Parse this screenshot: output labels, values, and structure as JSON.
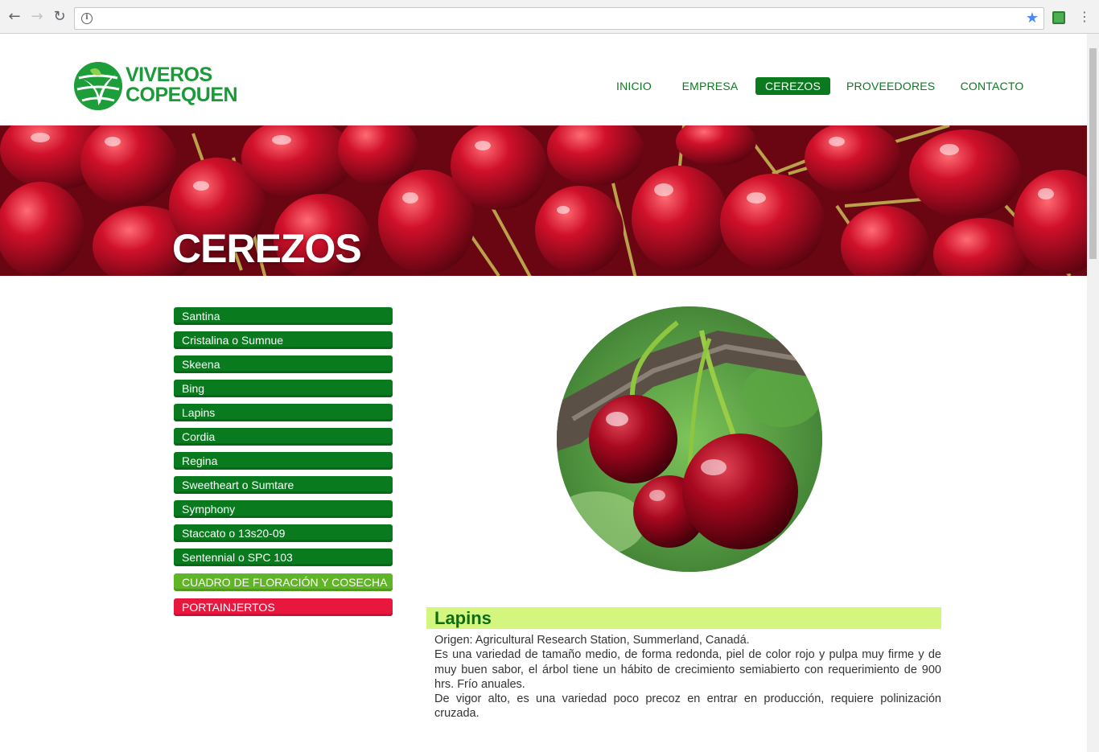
{
  "browser": {
    "url": "",
    "back_icon": "arrow-left-icon",
    "forward_icon": "arrow-right-icon",
    "reload_icon": "reload-icon"
  },
  "site": {
    "logo_line1": "VIVEROS",
    "logo_line2": "COPEQUEN",
    "nav": [
      {
        "label": "INICIO",
        "active": false
      },
      {
        "label": "EMPRESA",
        "active": false
      },
      {
        "label": "CEREZOS",
        "active": true
      },
      {
        "label": "PROVEEDORES",
        "active": false
      },
      {
        "label": "CONTACTO",
        "active": false
      }
    ],
    "brand_green": "#0b7a1e"
  },
  "banner": {
    "title": "CEREZOS"
  },
  "sidebar": {
    "items": [
      "Santina",
      "Cristalina o Sumnue",
      "Skeena",
      "Bing",
      "Lapins",
      "Cordia",
      "Regina",
      "Sweetheart o Sumtare",
      "Symphony",
      "Staccato o 13s20-09",
      "Sentennial o SPC 103"
    ],
    "cuadro": "CUADRO DE FLORACIÓN Y COSECHA",
    "portainjertos": "PORTAINJERTOS"
  },
  "variety": {
    "name": "Lapins",
    "paragraphs": [
      "Origen: Agricultural Research Station, Summerland, Canadá.",
      "Es una variedad de tamaño medio, de forma redonda, piel de color rojo y pulpa muy firme y de muy buen sabor, el árbol tiene un hábito de crecimiento semiabierto con requerimiento de 900 hrs. Frío anuales.",
      "De vigor alto, es una variedad poco precoz en entrar en producción, requiere polinización cruzada."
    ]
  }
}
